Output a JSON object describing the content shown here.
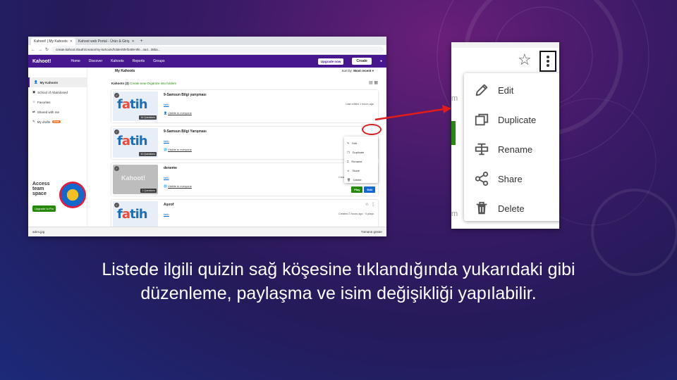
{
  "browser": {
    "tabs": [
      {
        "label": "Kahoot! | My Kahoots",
        "active": true
      },
      {
        "label": "Kahoot web Portal - Ürün & Giriş",
        "active": false
      }
    ],
    "url": "create.kahoot.it/auth/creator/my-kahoots/folder/6fef3489-9fe...4a4...38ba..."
  },
  "kahoot_nav": {
    "logo": "Kahoot!",
    "items": [
      "Home",
      "Discover",
      "Kahoots",
      "Reports",
      "Groups"
    ],
    "upgrade": "Upgrade now",
    "create": "Create"
  },
  "sidebar": {
    "items": [
      "My Kahoots",
      "School of Abandoned",
      "Favorites",
      "Shared with me",
      "My drafts"
    ],
    "drafts_badge": "Beta",
    "promo_title": "Access team space",
    "promo_button": "Upgrade to Pro"
  },
  "main": {
    "title": "My Kahoots",
    "sort_label": "Sort by:",
    "sort_value": "Most recent",
    "breadcrumb_label": "Kahoots (3)",
    "breadcrumb_create": "Create new",
    "breadcrumb_organize": "Organize into folders"
  },
  "kahoots": [
    {
      "title": "9-Samsun Bilgi yarışması",
      "author": "fatih",
      "questions": "16 Questions",
      "visibility": "Visible to everyone",
      "meta": "Last edited 1 hours ago",
      "thumb": "fatih"
    },
    {
      "title": "9-Samsun Bilgi Yarışması",
      "author": "fatih",
      "questions": "10 Questions",
      "visibility": "Visible to everyone",
      "meta": "Created 1 hours ago",
      "thumb": "fatih"
    },
    {
      "title": "deneme",
      "author": "fatih",
      "questions": "1 Questions",
      "visibility": "Visible to everyone",
      "meta": "Created 2 hours ago · 0 plays",
      "thumb": "kahoot"
    },
    {
      "title": "Aşırof",
      "author": "fatih",
      "questions": "",
      "visibility": "",
      "meta": "Created 3 hours ago · 0 plays",
      "thumb": "fatih"
    }
  ],
  "card_buttons": {
    "play": "Play",
    "edit": "Edit"
  },
  "small_menu": [
    "Edit",
    "Duplicate",
    "Rename",
    "Share",
    "Delete"
  ],
  "bottom_bar": {
    "file": "adım.jpg",
    "status": "Tümünü göster"
  },
  "zoom_menu": {
    "items": [
      {
        "label": "Edit",
        "icon": "pencil-icon"
      },
      {
        "label": "Duplicate",
        "icon": "duplicate-icon"
      },
      {
        "label": "Rename",
        "icon": "rename-icon"
      },
      {
        "label": "Share",
        "icon": "share-icon"
      },
      {
        "label": "Delete",
        "icon": "trash-icon"
      }
    ]
  },
  "caption": "Listede ilgili quizin sağ köşesine tıklandığında yukarıdaki gibi düzenleme, paylaşma ve isim değişikliği yapılabilir.",
  "colors": {
    "kahoot_purple": "#46178f",
    "play_green": "#26890c",
    "edit_blue": "#1368ce",
    "highlight_red": "#d62222"
  }
}
